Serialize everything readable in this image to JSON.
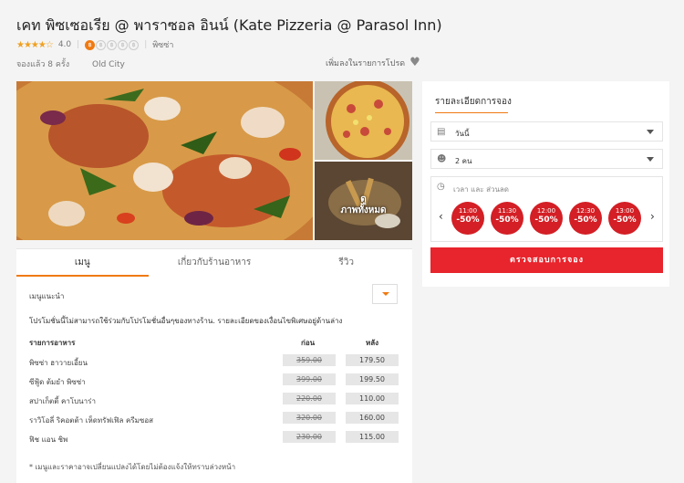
{
  "restaurant": {
    "title": "เคท พิซเซอเรีย @ พาราซอล อินน์ (Kate Pizzeria @ Parasol Inn)",
    "stars": "★★★★☆",
    "rating": "4.0",
    "price_level": [
      "฿",
      "฿",
      "฿",
      "฿",
      "฿"
    ],
    "cuisine": "พิซซ่า",
    "bookings": "จองแล้ว 8 ครั้ง",
    "area": "Old City",
    "favorite_label": "เพิ่มลงในรายการโปรด"
  },
  "photos": {
    "view_all_label_1": "ดู",
    "view_all_label_2": "ภาพทั้งหมด"
  },
  "tabs": [
    "เมนู",
    "เกี่ยวกับร้านอาหาร",
    "รีวิว"
  ],
  "menu": {
    "selector_label": "เมนูแนะนำ",
    "promo_note": "โปรโมชั่นนี้ไม่สามารถใช้ร่วมกับโปรโมชั่นอื่นๆของทางร้าน. รายละเอียดของเงื่อนไขพิเศษอยู่ด้านล่าง",
    "col_item": "รายการอาหาร",
    "col_before": "ก่อน",
    "col_after": "หลัง",
    "items": [
      {
        "name": "พิซซ่า ฮาวายเอี้ยน",
        "before": "359.00",
        "after": "179.50"
      },
      {
        "name": "ซีฟู้ด ต้มยำ พิซซ่า",
        "before": "399.00",
        "after": "199.50"
      },
      {
        "name": "สปาเก็ตตี้ คาโบนาร่า",
        "before": "220.00",
        "after": "110.00"
      },
      {
        "name": "ราวิโอลี่ ริคอตต้า เห็ดทรัฟเฟิล ครีมซอส",
        "before": "320.00",
        "after": "160.00"
      },
      {
        "name": "ฟิช แอน ชิพ",
        "before": "230.00",
        "after": "115.00"
      }
    ],
    "footnote": "* เมนูและราคาอาจเปลี่ยนแปลงได้โดยไม่ต้องแจ้งให้ทราบล่วงหน้า"
  },
  "booking": {
    "title": "รายละเอียดการจอง",
    "date_value": "วันนี้",
    "guests_value": "2 คน",
    "time_label": "เวลา และ ส่วนลด",
    "slots": [
      {
        "time": "11:00",
        "discount": "-50%"
      },
      {
        "time": "11:30",
        "discount": "-50%"
      },
      {
        "time": "12:00",
        "discount": "-50%"
      },
      {
        "time": "12:30",
        "discount": "-50%"
      },
      {
        "time": "13:00",
        "discount": "-50%"
      }
    ],
    "check_button": "ตรวจสอบการจอง"
  },
  "colors": {
    "accent": "#f07a12",
    "primary_button": "#e8242c",
    "discount_badge": "#d31f25"
  }
}
